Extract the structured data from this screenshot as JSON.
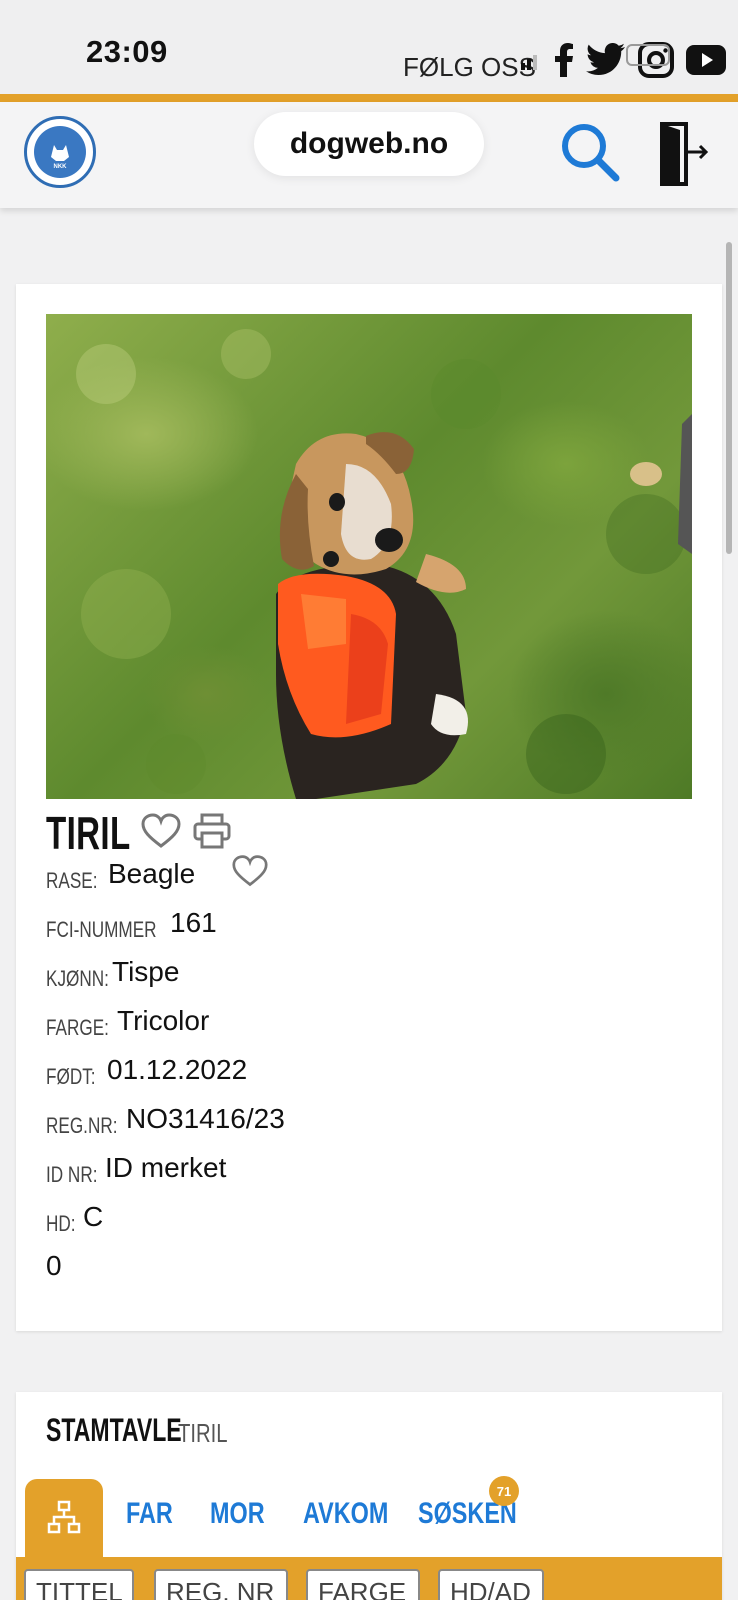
{
  "status_bar": {
    "time": "23:09",
    "follow_label": "FØLG OSS"
  },
  "header": {
    "url": "dogweb.no",
    "logo_text": "NORSK KENNEL KLUB"
  },
  "dog": {
    "name": "TIRIL",
    "fields": [
      {
        "label": "RASE:",
        "value": "Beagle"
      },
      {
        "label": "FCI-NUMMER",
        "value": "161"
      },
      {
        "label": "KJØNN:",
        "value": "Tispe"
      },
      {
        "label": "FARGE:",
        "value": "Tricolor"
      },
      {
        "label": "FØDT:",
        "value": "01.12.2022"
      },
      {
        "label": "REG.NR:",
        "value": "NO31416/23"
      },
      {
        "label": "ID NR:",
        "value": "ID merket"
      },
      {
        "label": "HD:",
        "value": "C"
      }
    ],
    "extra_value": "0"
  },
  "pedigree": {
    "title": "STAMTAVLE",
    "dog_name": "TIRIL",
    "tabs": [
      "FAR",
      "MOR",
      "AVKOM",
      "SØSKEN"
    ],
    "siblings_badge": "71",
    "table_headers": [
      "TITTEL",
      "REG. NR",
      "FARGE",
      "HD/AD"
    ]
  },
  "colors": {
    "accent": "#e3a12a",
    "link": "#1e7ad6"
  },
  "icons": [
    "signal-icon",
    "facebook-icon",
    "wifi-icon",
    "twitter-icon",
    "instagram-icon",
    "youtube-icon",
    "search-icon",
    "logout-icon",
    "heart-icon",
    "print-icon",
    "pedigree-tree-icon"
  ]
}
